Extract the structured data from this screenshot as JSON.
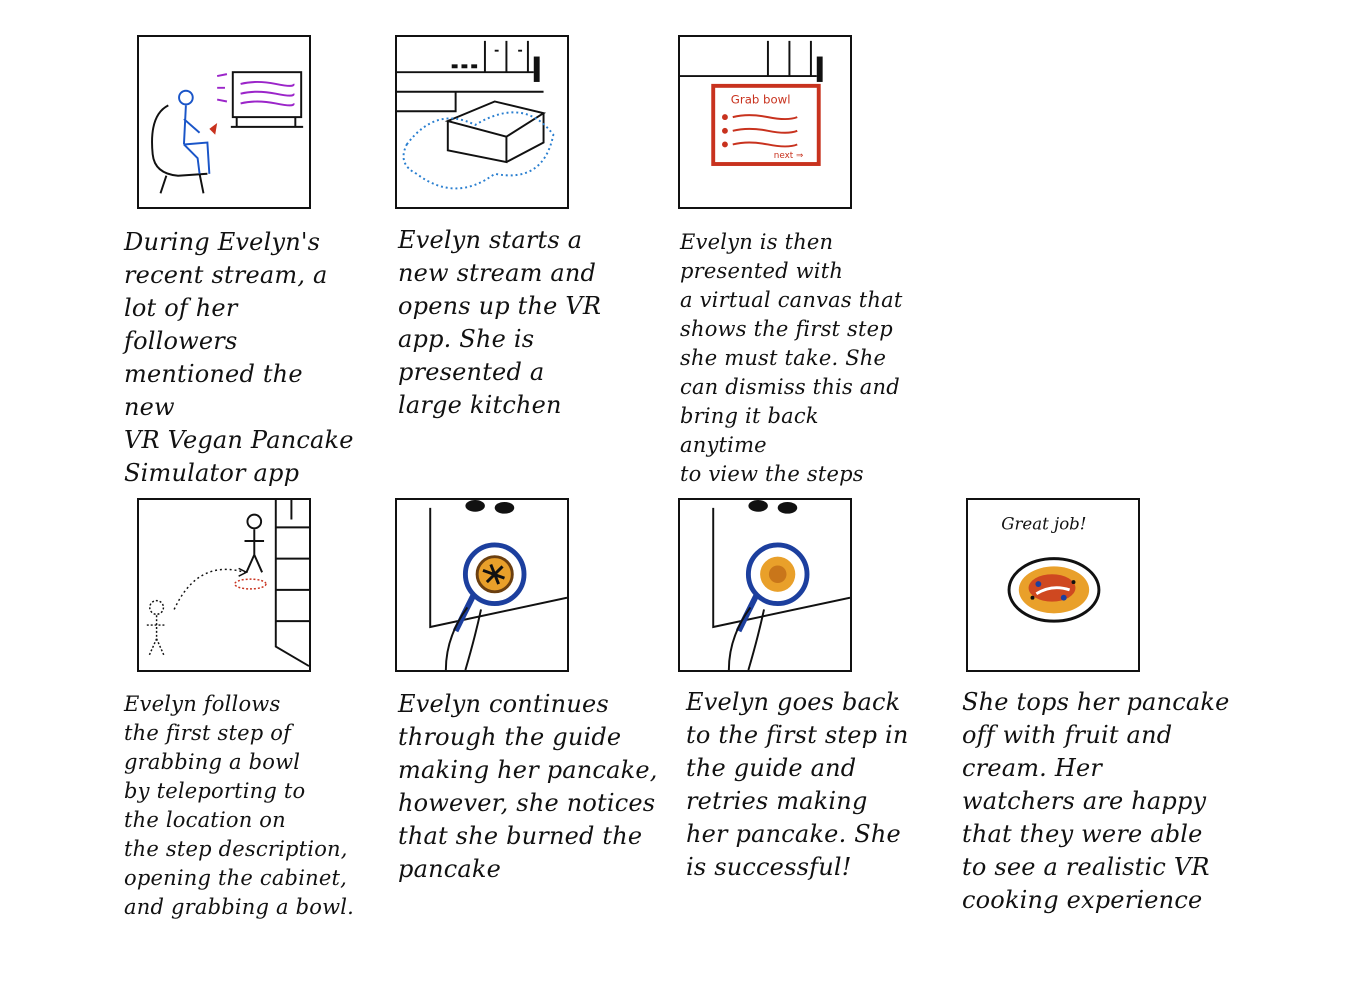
{
  "panels": [
    {
      "caption": "During Evelyn's\nrecent stream, a\nlot of her followers\nmentioned the new\nVR Vegan Pancake\nSimulator app"
    },
    {
      "caption": "Evelyn starts a\nnew stream and\nopens up the VR\napp. She is\npresented a\nlarge kitchen"
    },
    {
      "caption": "Evelyn is then\npresented with\na virtual canvas that\nshows the first step\nshe must take. She\ncan dismiss this and\nbring it back anytime\nto view the steps",
      "canvas_title": "Grab bowl",
      "canvas_next": "next ⇒"
    },
    {
      "caption": "Evelyn follows\nthe first step of\ngrabbing a bowl\nby teleporting to\nthe location on\nthe step description,\nopening the cabinet,\nand grabbing a bowl."
    },
    {
      "caption": "Evelyn continues\nthrough the guide\nmaking her pancake,\nhowever, she notices\nthat she burned the\npancake"
    },
    {
      "caption": "Evelyn goes back\nto the first step in\nthe guide and\nretries making\nher pancake. She\nis successful!"
    },
    {
      "caption": "She tops her pancake\noff with fruit and\ncream. Her\nwatchers are happy\nthat they were able\nto see a realistic VR\ncooking experience",
      "panel_text": "Great job!"
    }
  ],
  "colors": {
    "ink": "#111111",
    "blue": "#1a55c8",
    "purple": "#9b25c9",
    "red": "#c8321e",
    "pan_blue": "#1c3f9e",
    "pancake": "#e9a02a",
    "burnt": "#6b3f10"
  }
}
